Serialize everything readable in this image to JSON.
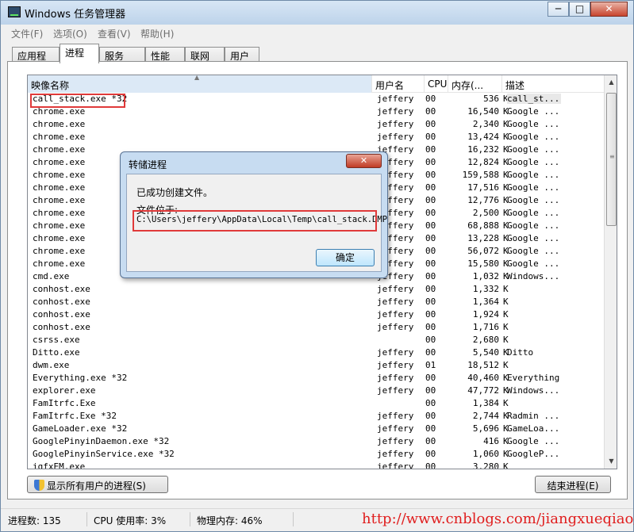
{
  "window": {
    "title": "Windows 任务管理器",
    "minimize": "─",
    "maximize": "□",
    "close": "✕"
  },
  "menu": [
    "文件(F)",
    "选项(O)",
    "查看(V)",
    "帮助(H)"
  ],
  "tabs": [
    "应用程序",
    "进程",
    "服务",
    "性能",
    "联网",
    "用户"
  ],
  "active_tab": "进程",
  "columns": {
    "name": "映像名称",
    "user": "用户名",
    "cpu": "CPU",
    "mem": "内存(...",
    "desc": "描述",
    "sort_arrow": "▲"
  },
  "rows": [
    {
      "name": "call_stack.exe *32",
      "user": "jeffery",
      "cpu": "00",
      "mem": "536",
      "k": "K",
      "desc": "call_st..."
    },
    {
      "name": "chrome.exe",
      "user": "jeffery",
      "cpu": "00",
      "mem": "16,540",
      "k": "K",
      "desc": "Google ..."
    },
    {
      "name": "chrome.exe",
      "user": "jeffery",
      "cpu": "00",
      "mem": "2,340",
      "k": "K",
      "desc": "Google ..."
    },
    {
      "name": "chrome.exe",
      "user": "jeffery",
      "cpu": "00",
      "mem": "13,424",
      "k": "K",
      "desc": "Google ..."
    },
    {
      "name": "chrome.exe",
      "user": "jeffery",
      "cpu": "00",
      "mem": "16,232",
      "k": "K",
      "desc": "Google ..."
    },
    {
      "name": "chrome.exe",
      "user": "jeffery",
      "cpu": "00",
      "mem": "12,824",
      "k": "K",
      "desc": "Google ..."
    },
    {
      "name": "chrome.exe",
      "user": "jeffery",
      "cpu": "00",
      "mem": "159,588",
      "k": "K",
      "desc": "Google ..."
    },
    {
      "name": "chrome.exe",
      "user": "jeffery",
      "cpu": "00",
      "mem": "17,516",
      "k": "K",
      "desc": "Google ..."
    },
    {
      "name": "chrome.exe",
      "user": "jeffery",
      "cpu": "00",
      "mem": "12,776",
      "k": "K",
      "desc": "Google ..."
    },
    {
      "name": "chrome.exe",
      "user": "jeffery",
      "cpu": "00",
      "mem": "2,500",
      "k": "K",
      "desc": "Google ..."
    },
    {
      "name": "chrome.exe",
      "user": "jeffery",
      "cpu": "00",
      "mem": "68,888",
      "k": "K",
      "desc": "Google ..."
    },
    {
      "name": "chrome.exe",
      "user": "jeffery",
      "cpu": "00",
      "mem": "13,228",
      "k": "K",
      "desc": "Google ..."
    },
    {
      "name": "chrome.exe",
      "user": "jeffery",
      "cpu": "00",
      "mem": "56,072",
      "k": "K",
      "desc": "Google ..."
    },
    {
      "name": "chrome.exe",
      "user": "jeffery",
      "cpu": "00",
      "mem": "15,580",
      "k": "K",
      "desc": "Google ..."
    },
    {
      "name": "cmd.exe",
      "user": "jeffery",
      "cpu": "00",
      "mem": "1,032",
      "k": "K",
      "desc": "Windows..."
    },
    {
      "name": "conhost.exe",
      "user": "jeffery",
      "cpu": "00",
      "mem": "1,332",
      "k": "K",
      "desc": ""
    },
    {
      "name": "conhost.exe",
      "user": "jeffery",
      "cpu": "00",
      "mem": "1,364",
      "k": "K",
      "desc": ""
    },
    {
      "name": "conhost.exe",
      "user": "jeffery",
      "cpu": "00",
      "mem": "1,924",
      "k": "K",
      "desc": ""
    },
    {
      "name": "conhost.exe",
      "user": "jeffery",
      "cpu": "00",
      "mem": "1,716",
      "k": "K",
      "desc": ""
    },
    {
      "name": "csrss.exe",
      "user": "",
      "cpu": "00",
      "mem": "2,680",
      "k": "K",
      "desc": ""
    },
    {
      "name": "Ditto.exe",
      "user": "jeffery",
      "cpu": "00",
      "mem": "5,540",
      "k": "K",
      "desc": "Ditto"
    },
    {
      "name": "dwm.exe",
      "user": "jeffery",
      "cpu": "01",
      "mem": "18,512",
      "k": "K",
      "desc": ""
    },
    {
      "name": "Everything.exe *32",
      "user": "jeffery",
      "cpu": "00",
      "mem": "40,460",
      "k": "K",
      "desc": "Everything"
    },
    {
      "name": "explorer.exe",
      "user": "jeffery",
      "cpu": "00",
      "mem": "47,772",
      "k": "K",
      "desc": "Windows..."
    },
    {
      "name": "FamItrfc.Exe",
      "user": "",
      "cpu": "00",
      "mem": "1,384",
      "k": "K",
      "desc": ""
    },
    {
      "name": "FamItrfc.Exe *32",
      "user": "jeffery",
      "cpu": "00",
      "mem": "2,744",
      "k": "K",
      "desc": "Radmin ..."
    },
    {
      "name": "GameLoader.exe *32",
      "user": "jeffery",
      "cpu": "00",
      "mem": "5,696",
      "k": "K",
      "desc": "GameLoa..."
    },
    {
      "name": "GooglePinyinDaemon.exe *32",
      "user": "jeffery",
      "cpu": "00",
      "mem": "416",
      "k": "K",
      "desc": "Google ..."
    },
    {
      "name": "GooglePinyinService.exe *32",
      "user": "jeffery",
      "cpu": "00",
      "mem": "1,060",
      "k": "K",
      "desc": "GoogleP..."
    },
    {
      "name": "igfxEM.exe",
      "user": "jeffery",
      "cpu": "00",
      "mem": "3,280",
      "k": "K",
      "desc": ""
    }
  ],
  "buttons": {
    "show_all": "显示所有用户的进程(S)",
    "end_process": "结束进程(E)"
  },
  "status": {
    "processes": "进程数: 135",
    "cpu": "CPU 使用率: 3%",
    "memory": "物理内存: 46%"
  },
  "watermark": "http://www.cnblogs.com/jiangxueqiao/",
  "dialog": {
    "title": "转储进程",
    "close": "✕",
    "message": "已成功创建文件。",
    "location_label": "文件位于:",
    "path": "C:\\Users\\jeffery\\AppData\\Local\\Temp\\call_stack.DMP",
    "ok": "确定"
  },
  "colors": {
    "highlight": "#e03a3a",
    "watermark": "#e01e1e"
  }
}
